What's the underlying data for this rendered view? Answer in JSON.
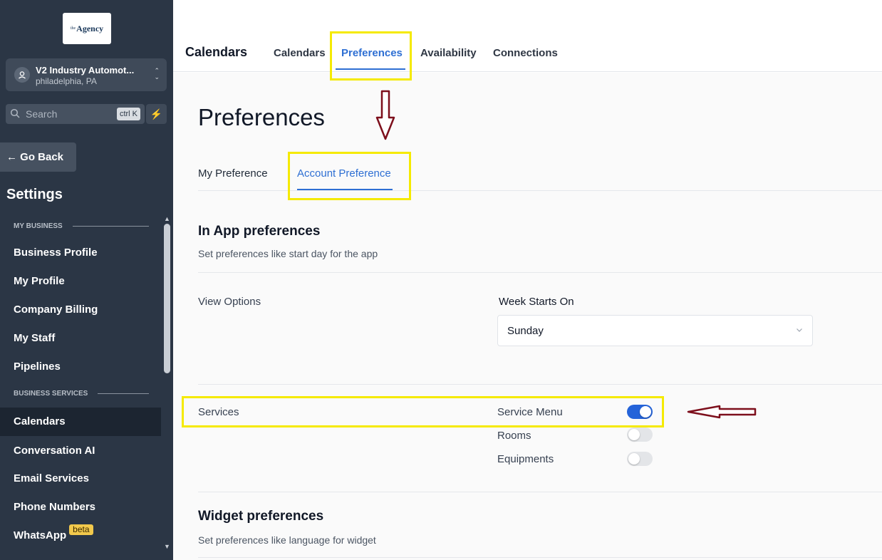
{
  "sidebar": {
    "logo_sup": "the",
    "logo_text": "Agency",
    "location": {
      "name": "V2 Industry Automot...",
      "city": "philadelphia, PA"
    },
    "search": {
      "placeholder": "Search",
      "shortcut": "ctrl K"
    },
    "go_back": "← Go Back",
    "title": "Settings",
    "section_my_business": "MY BUSINESS",
    "section_business_services": "BUSINESS SERVICES",
    "items": [
      {
        "label": "Business Profile"
      },
      {
        "label": "My Profile"
      },
      {
        "label": "Company Billing"
      },
      {
        "label": "My Staff"
      },
      {
        "label": "Pipelines"
      },
      {
        "label": "Calendars",
        "active": true
      },
      {
        "label": "Conversation AI"
      },
      {
        "label": "Email Services"
      },
      {
        "label": "Phone Numbers"
      },
      {
        "label": "WhatsApp",
        "badge": "beta"
      }
    ]
  },
  "topbar": {
    "title": "Calendars",
    "tabs": [
      {
        "label": "Calendars"
      },
      {
        "label": "Preferences",
        "active": true
      },
      {
        "label": "Availability"
      },
      {
        "label": "Connections"
      }
    ]
  },
  "main": {
    "title": "Preferences",
    "sub_tabs": [
      {
        "label": "My Preference"
      },
      {
        "label": "Account Preference",
        "active": true
      }
    ],
    "in_app": {
      "title": "In App preferences",
      "desc": "Set preferences like start day for the app",
      "view_options_label": "View Options",
      "week_starts_label": "Week Starts On",
      "week_starts_value": "Sunday"
    },
    "services": {
      "label": "Services",
      "items": [
        {
          "label": "Service Menu",
          "enabled": true
        },
        {
          "label": "Rooms",
          "enabled": false
        },
        {
          "label": "Equipments",
          "enabled": false
        }
      ]
    },
    "widget": {
      "title": "Widget preferences",
      "desc": "Set preferences like language for widget"
    }
  },
  "colors": {
    "sidebar_bg": "#2b3645",
    "accent": "#2e6fd3",
    "toggle_on": "#2463d9",
    "highlight": "#f5ea00",
    "arrow": "#7d0f1c"
  }
}
